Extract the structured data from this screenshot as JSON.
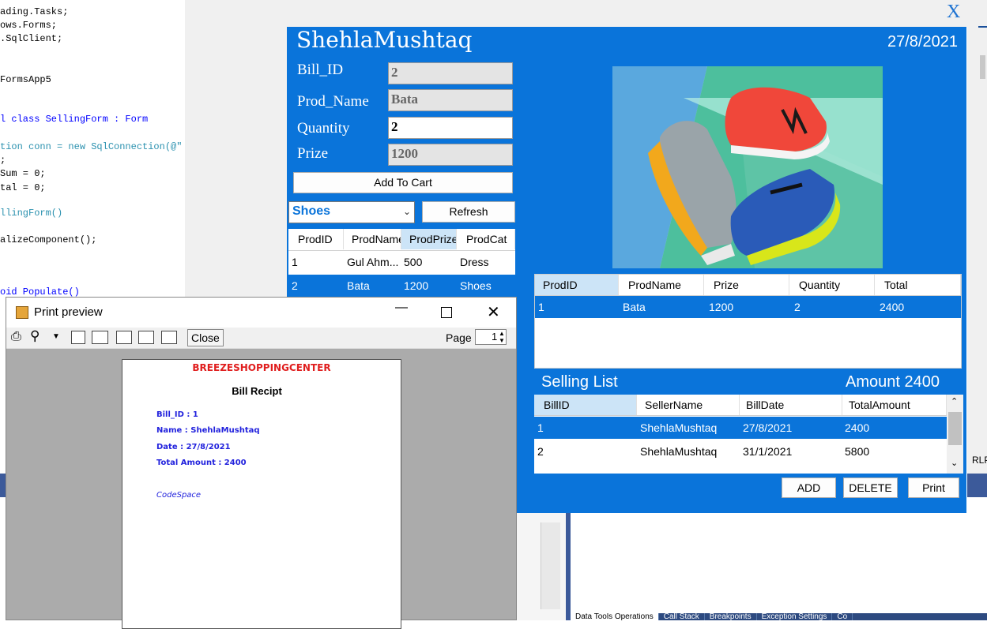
{
  "code_editor": {
    "lines": [
      "ading.Tasks;",
      "ows.Forms;",
      ".SqlClient;",
      "FormsApp5",
      "l class SellingForm : Form",
      "tion conn = new SqlConnection(@\"",
      ";",
      "Sum = 0;",
      "tal = 0;",
      "llingForm()",
      "alizeComponent();",
      "oid Populate()"
    ],
    "right_clip": "RLP"
  },
  "vs_tabs": [
    "Data Tools Operations",
    "Call Stack",
    "Breakpoints",
    "Exception Settings",
    "Co"
  ],
  "selling_form": {
    "close_label": "X",
    "user": "ShehlaMushtaq",
    "date": "27/8/2021",
    "fields": {
      "bill_id": {
        "label": "Bill_ID",
        "value": "2"
      },
      "prod_name": {
        "label": "Prod_Name",
        "value": "Bata"
      },
      "quantity": {
        "label": "Quantity",
        "value": "2"
      },
      "prize": {
        "label": "Prize",
        "value": "1200"
      }
    },
    "add_to_cart_label": "Add To Cart",
    "category_selected": "Shoes",
    "refresh_label": "Refresh",
    "products": {
      "headers": [
        "ProdID",
        "ProdName",
        "ProdPrize",
        "ProdCat"
      ],
      "rows": [
        [
          "1",
          "Gul Ahm...",
          "500",
          "Dress"
        ],
        [
          "2",
          "Bata",
          "1200",
          "Shoes"
        ]
      ]
    },
    "cart": {
      "headers": [
        "ProdID",
        "ProdName",
        "Prize",
        "Quantity",
        "Total"
      ],
      "rows": [
        [
          "1",
          "Bata",
          "1200",
          "2",
          "2400"
        ]
      ]
    },
    "selling_list_label": "Selling List",
    "amount_label": "Amount 2400",
    "selling_list": {
      "headers": [
        "BillID",
        "SellerName",
        "BillDate",
        "TotalAmount"
      ],
      "rows": [
        [
          "1",
          "ShehlaMushtaq",
          "27/8/2021",
          "2400"
        ],
        [
          "2",
          "ShehlaMushtaq",
          "31/1/2021",
          "5800"
        ]
      ]
    },
    "buttons": {
      "add": "ADD",
      "delete": "DELETE",
      "print": "Print"
    }
  },
  "print_preview": {
    "title": "Print preview",
    "close_label": "Close",
    "page_label": "Page",
    "page_value": "1",
    "receipt": {
      "shop": "BREEZESHOPPINGCENTER",
      "heading": "Bill Recipt",
      "bill_id": "Bill_ID : 1",
      "name": "Name : ShehlaMushtaq",
      "date": "Date : 27/8/2021",
      "total": "Total Amount : 2400",
      "footer": "CodeSpace"
    }
  },
  "colors": {
    "form_blue": "#0a74da",
    "shop_red": "#e01e1e",
    "receipt_blue": "#2222dd"
  }
}
